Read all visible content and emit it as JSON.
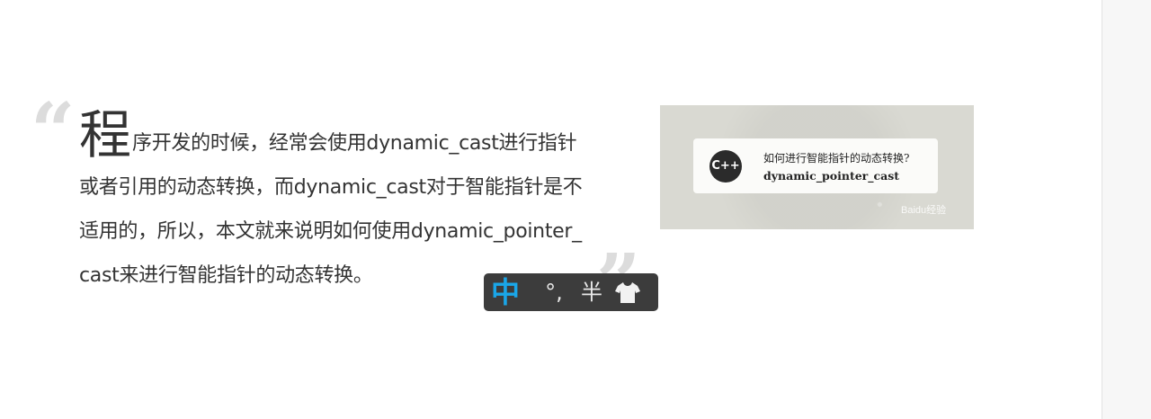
{
  "article": {
    "quote_open": "“",
    "quote_close": "”",
    "dropcap": "程",
    "intro_text": "序开发的时候，经常会使用dynamic_cast进行指针或者引用的动态转换，而dynamic_cast对于智能指针是不适用的，所以，本文就来说明如何使用dynamic_pointer_cast来进行智能指针的动态转换。"
  },
  "thumbnail": {
    "logo_text": "C++",
    "question": "如何进行智能指针的动态转换?",
    "answer": "dynamic_pointer_cast",
    "watermark": "Baidu经验"
  },
  "ime_toolbar": {
    "mode": "中",
    "punctuation": "°,",
    "width": "半",
    "skin_icon": "tshirt-icon"
  }
}
